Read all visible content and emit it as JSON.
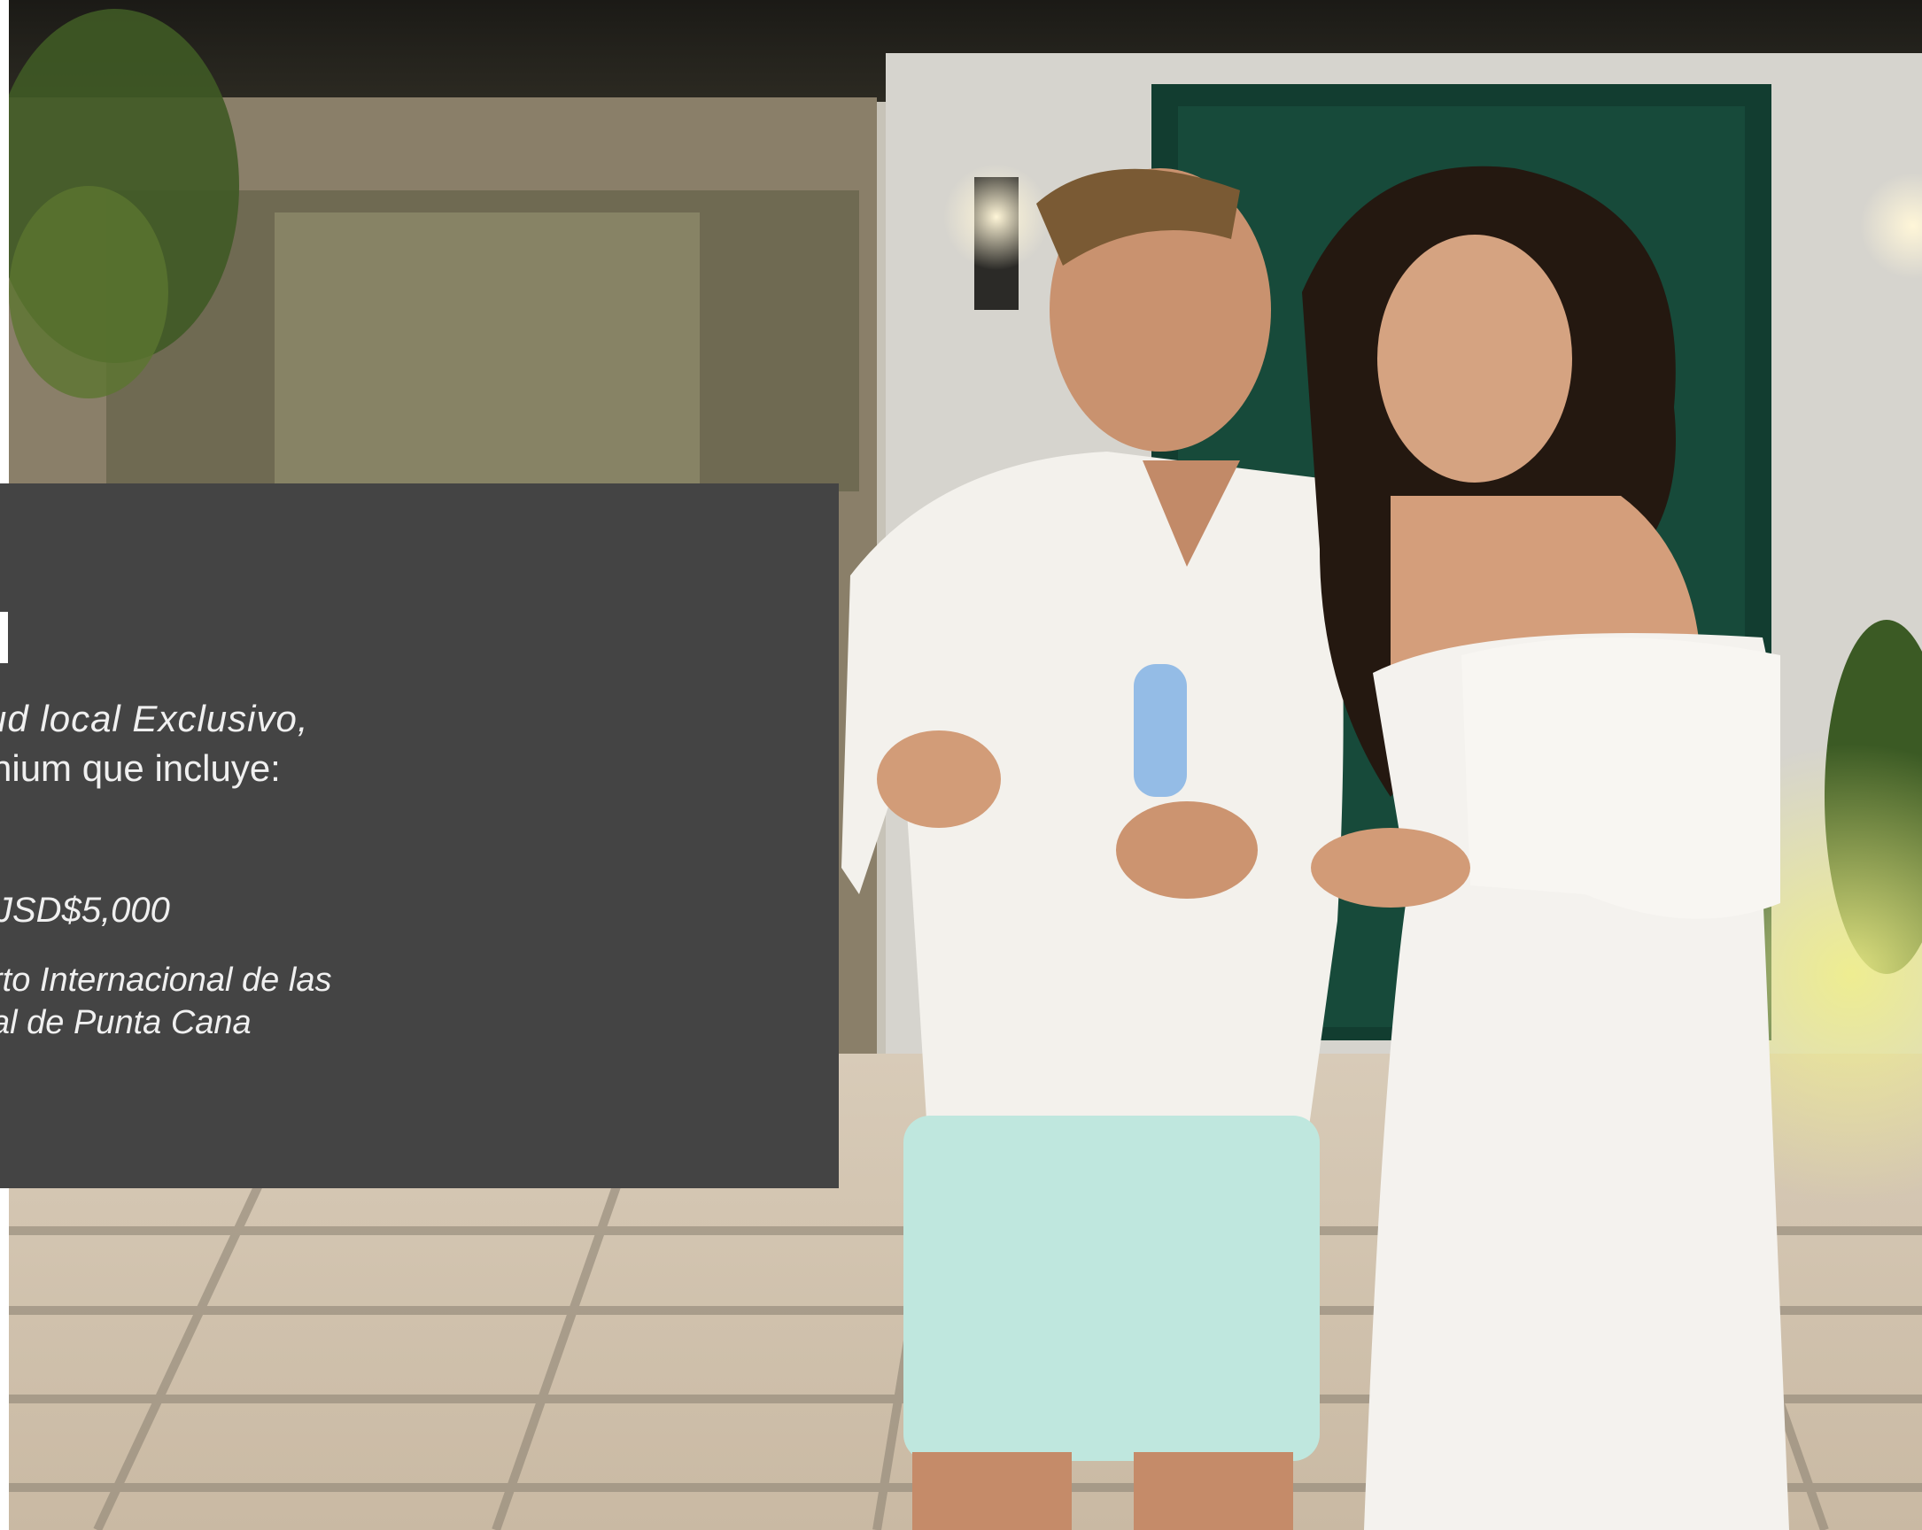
{
  "panel": {
    "background": "#444444",
    "text_color": "#f0f0f0",
    "intro_line_1": "ud  local  Exclusivo,",
    "intro_line_2": "nium que incluye:",
    "price": "JSD$5,000",
    "airport_line_1": "rto Internacional de las",
    "airport_line_2": "al de Punta Cana"
  },
  "photo": {
    "subject": "smiling couple walking in front of a house"
  }
}
